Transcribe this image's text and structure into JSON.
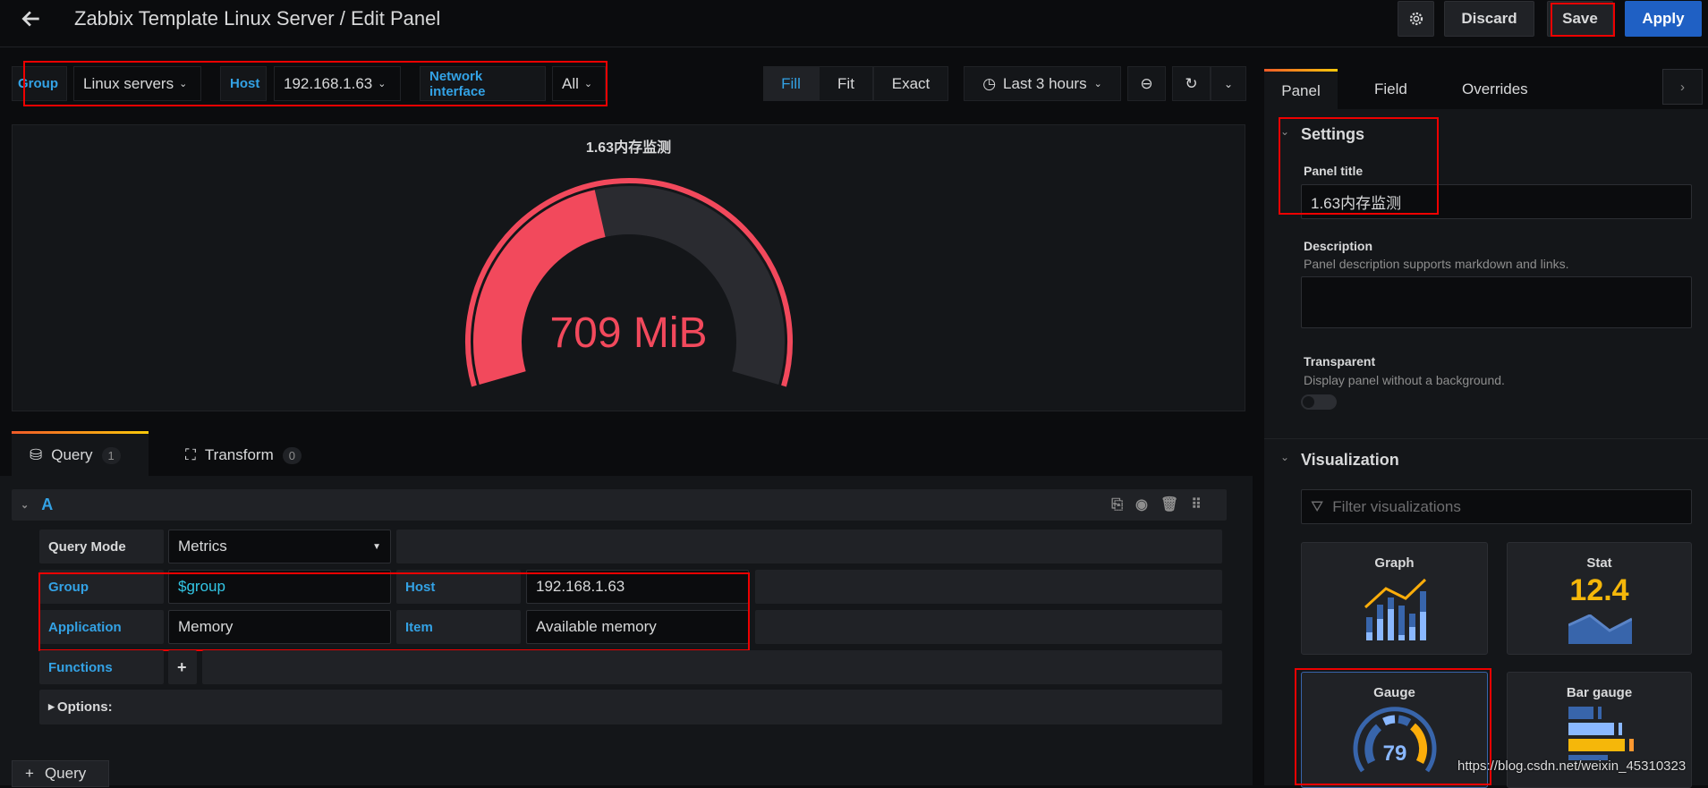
{
  "header": {
    "title": "Zabbix Template Linux Server / Edit Panel",
    "discard": "Discard",
    "save": "Save",
    "apply": "Apply"
  },
  "variables": [
    {
      "label": "Group",
      "value": "Linux servers"
    },
    {
      "label": "Host",
      "value": "192.168.1.63"
    },
    {
      "label": "Network interface",
      "value": "All"
    }
  ],
  "display_modes": [
    "Fill",
    "Fit",
    "Exact"
  ],
  "time_range": "Last 3 hours",
  "panel": {
    "title": "1.63内存监测",
    "value": "709 MiB",
    "gauge_fraction": 0.44,
    "color": "#f2495c"
  },
  "query_tabs": [
    {
      "label": "Query",
      "count": "1"
    },
    {
      "label": "Transform",
      "count": "0"
    }
  ],
  "query": {
    "ref": "A",
    "query_mode_label": "Query Mode",
    "query_mode": "Metrics",
    "group_label": "Group",
    "group": "$group",
    "host_label": "Host",
    "host": "192.168.1.63",
    "application_label": "Application",
    "application": "Memory",
    "item_label": "Item",
    "item": "Available memory",
    "functions_label": "Functions",
    "options_label": "Options:"
  },
  "add_query": "Query",
  "right": {
    "tabs": [
      "Panel",
      "Field",
      "Overrides"
    ],
    "settings": "Settings",
    "panel_title_label": "Panel title",
    "panel_title": "1.63内存监测",
    "description_label": "Description",
    "description_sub": "Panel description supports markdown and links.",
    "transparent_label": "Transparent",
    "transparent_sub": "Display panel without a background.",
    "visualization": "Visualization",
    "filter_placeholder": "Filter visualizations",
    "cards": [
      "Graph",
      "Stat",
      "Gauge",
      "Bar gauge"
    ],
    "stat_value": "12.4",
    "gauge_value": "79"
  },
  "watermark": "https://blog.csdn.net/weixin_45310323"
}
